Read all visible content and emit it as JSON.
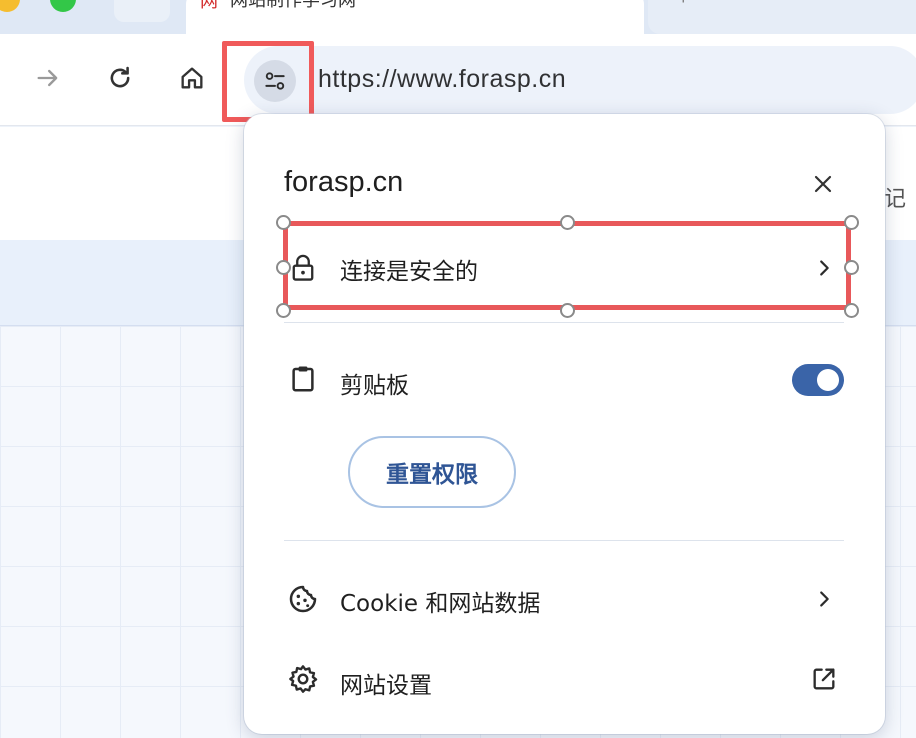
{
  "browser": {
    "active_tab": {
      "favicon_glyph": "网",
      "title": "网站制作学习网",
      "close_glyph": "×"
    },
    "new_tab_glyph": "+",
    "toolbar": {
      "forward_icon": "arrow-right-icon",
      "reload_icon": "reload-icon",
      "home_icon": "home-icon",
      "site_info_icon": "tune-icon"
    },
    "omnibox": {
      "url": "https://www.forasp.cn"
    }
  },
  "page": {
    "edge_text": "记"
  },
  "popup": {
    "title": "forasp.cn",
    "close_icon": "close-icon",
    "connection": {
      "icon": "lock-icon",
      "label": "连接是安全的"
    },
    "clipboard": {
      "icon": "clipboard-icon",
      "label": "剪贴板",
      "enabled": true
    },
    "reset_button": "重置权限",
    "cookies": {
      "icon": "cookie-icon",
      "label": "Cookie 和网站数据"
    },
    "site_settings": {
      "icon": "gear-icon",
      "label": "网站设置",
      "external_icon": "open-in-new-icon"
    }
  },
  "colors": {
    "annotation_red": "#e8585a",
    "toggle_on": "#3a64a8",
    "button_text": "#2f5595"
  }
}
